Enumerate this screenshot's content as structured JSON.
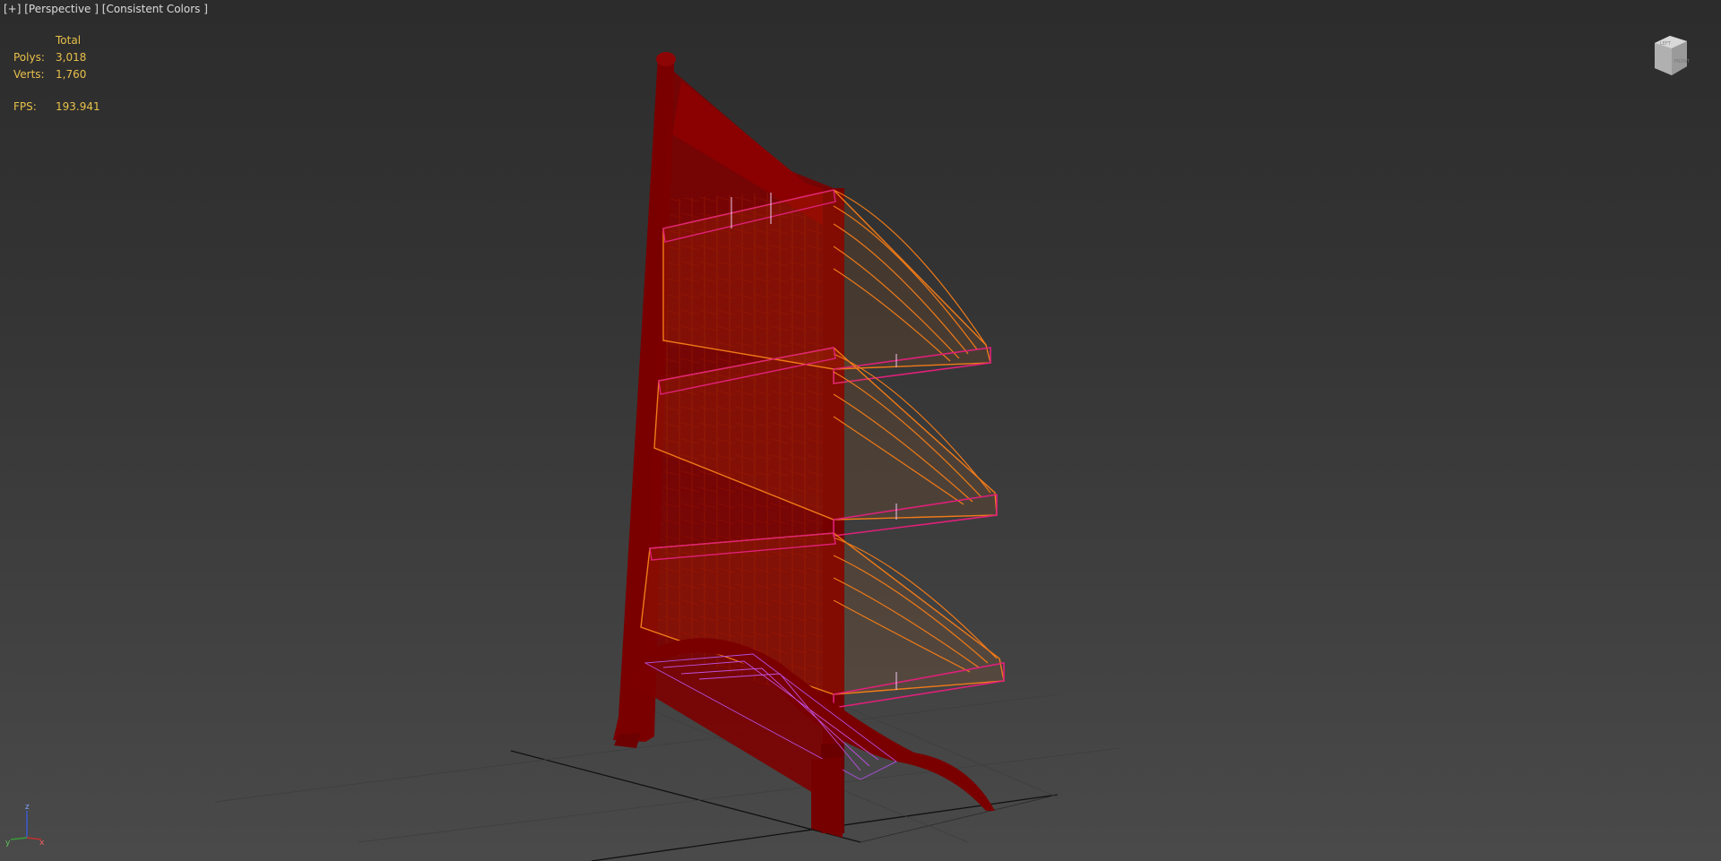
{
  "viewport": {
    "label_plus": "[+]",
    "label_view": "[Perspective ]",
    "label_shading": "[Consistent Colors ]"
  },
  "stats": {
    "header": "Total",
    "polys_label": "Polys:",
    "polys_value": "3,018",
    "verts_label": "Verts:",
    "verts_value": "1,760",
    "fps_label": "FPS:",
    "fps_value": "193.941"
  },
  "axis_gizmo": {
    "z": "z",
    "x": "x",
    "y": "y"
  },
  "colors": {
    "frame": "#7a0000",
    "wire_orange": "#f07a18",
    "wire_magenta": "#e0207a",
    "wire_yellow": "#f0b020",
    "grid": "#111111"
  },
  "icons": {
    "viewcube": "viewcube-icon",
    "axis": "axis-tripod-icon"
  }
}
